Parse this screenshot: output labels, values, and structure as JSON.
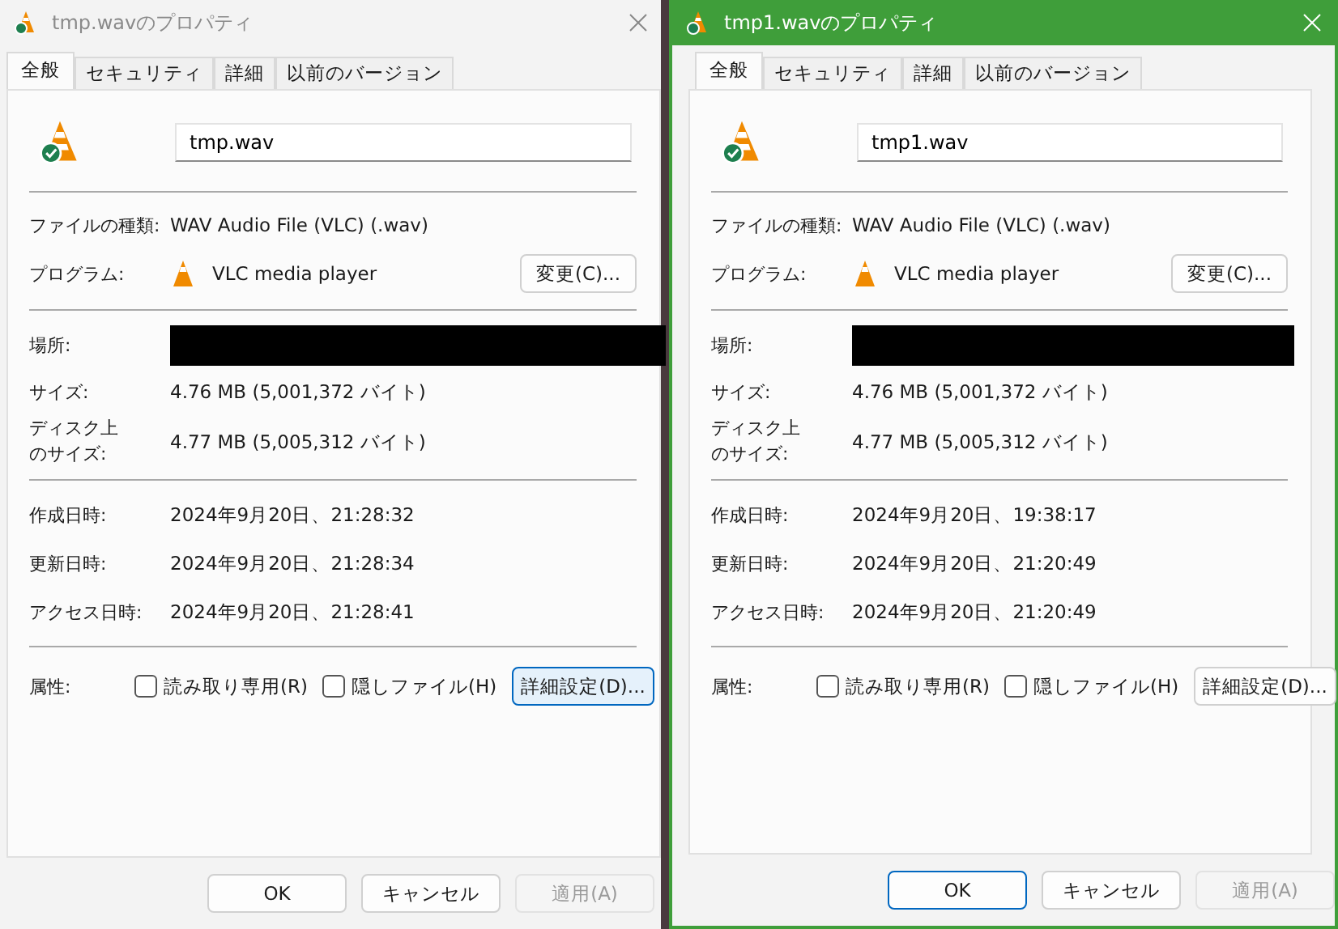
{
  "dialogs": [
    {
      "title": "tmp.wavのプロパティ",
      "active": false,
      "tabs": [
        {
          "label": "全般",
          "selected": true
        },
        {
          "label": "セキュリティ",
          "selected": false
        },
        {
          "label": "詳細",
          "selected": false
        },
        {
          "label": "以前のバージョン",
          "selected": false
        }
      ],
      "name_field": {
        "value": "tmp.wav"
      },
      "file_type": {
        "label": "ファイルの種類:",
        "value": "WAV Audio File (VLC) (.wav)"
      },
      "program": {
        "label": "プログラム:",
        "value": "VLC media player",
        "button": {
          "label": "変更(C)...",
          "focused": false
        }
      },
      "location": {
        "label": "場所:",
        "redacted": true
      },
      "size": {
        "label": "サイズ:",
        "value": "4.76 MB (5,001,372 バイト)"
      },
      "disk_size": {
        "label": "ディスク上のサイズ:",
        "value": "4.77 MB (5,005,312 バイト)"
      },
      "dates": [
        {
          "label": "作成日時:",
          "value": "2024年9月20日、21:28:32"
        },
        {
          "label": "更新日時:",
          "value": "2024年9月20日、21:28:34"
        },
        {
          "label": "アクセス日時:",
          "value": "2024年9月20日、21:28:41"
        }
      ],
      "attributes": {
        "label": "属性:",
        "checkboxes": [
          {
            "label": "読み取り専用(R)",
            "checked": false
          },
          {
            "label": "隠しファイル(H)",
            "checked": false
          }
        ],
        "button": {
          "label": "詳細設定(D)...",
          "focused": true
        }
      },
      "buttons": [
        {
          "label": "OK",
          "focused": false,
          "disabled": false
        },
        {
          "label": "キャンセル",
          "focused": false,
          "disabled": false
        },
        {
          "label": "適用(A)",
          "focused": false,
          "disabled": true
        }
      ]
    },
    {
      "title": "tmp1.wavのプロパティ",
      "active": true,
      "tabs": [
        {
          "label": "全般",
          "selected": true
        },
        {
          "label": "セキュリティ",
          "selected": false
        },
        {
          "label": "詳細",
          "selected": false
        },
        {
          "label": "以前のバージョン",
          "selected": false
        }
      ],
      "name_field": {
        "value": "tmp1.wav"
      },
      "file_type": {
        "label": "ファイルの種類:",
        "value": "WAV Audio File (VLC) (.wav)"
      },
      "program": {
        "label": "プログラム:",
        "value": "VLC media player",
        "button": {
          "label": "変更(C)...",
          "focused": false
        }
      },
      "location": {
        "label": "場所:",
        "redacted": true
      },
      "size": {
        "label": "サイズ:",
        "value": "4.76 MB (5,001,372 バイト)"
      },
      "disk_size": {
        "label": "ディスク上のサイズ:",
        "value": "4.77 MB (5,005,312 バイト)"
      },
      "dates": [
        {
          "label": "作成日時:",
          "value": "2024年9月20日、19:38:17"
        },
        {
          "label": "更新日時:",
          "value": "2024年9月20日、21:20:49"
        },
        {
          "label": "アクセス日時:",
          "value": "2024年9月20日、21:20:49"
        }
      ],
      "attributes": {
        "label": "属性:",
        "checkboxes": [
          {
            "label": "読み取り専用(R)",
            "checked": false
          },
          {
            "label": "隠しファイル(H)",
            "checked": false
          }
        ],
        "button": {
          "label": "詳細設定(D)...",
          "focused": false
        }
      },
      "buttons": [
        {
          "label": "OK",
          "focused": true,
          "disabled": false
        },
        {
          "label": "キャンセル",
          "focused": false,
          "disabled": false
        },
        {
          "label": "適用(A)",
          "focused": false,
          "disabled": true
        }
      ]
    }
  ]
}
